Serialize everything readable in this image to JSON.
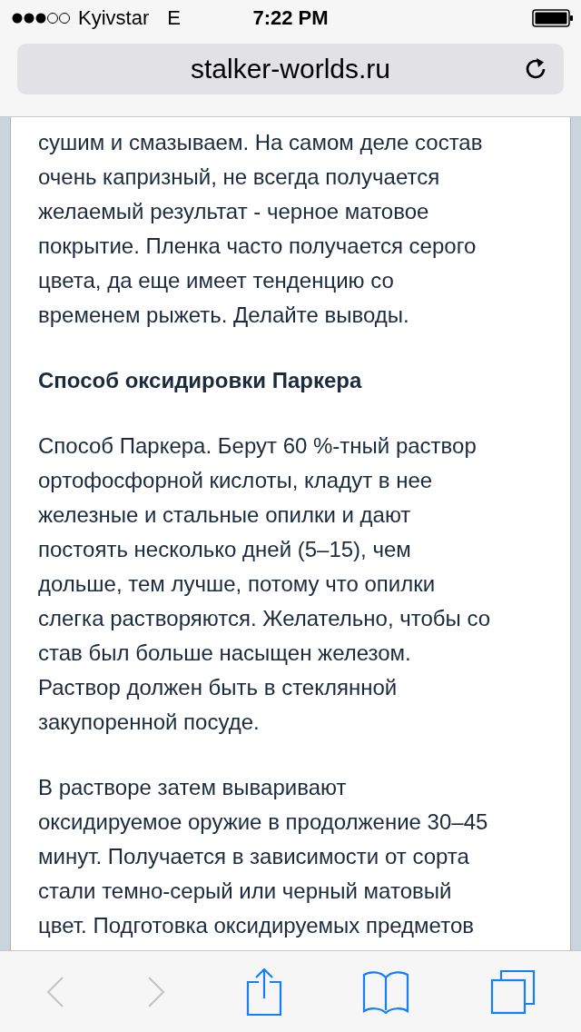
{
  "status_bar": {
    "carrier": "Kyivstar",
    "network": "E",
    "time": "7:22 PM"
  },
  "address_bar": {
    "url": "stalker-worlds.ru"
  },
  "article": [
    {
      "kind": "paragraph",
      "lines": [
        "сушим и смазываем. На самом деле состав",
        "очень капризный, не всегда получается",
        "желаемый результат - черное матовое",
        "покрытие. Пленка часто получается серого",
        "цвета, да еще имеет тенденцию со",
        "временем рыжеть. Делайте выводы."
      ]
    },
    {
      "kind": "heading",
      "lines": [
        "Способ оксидировки Паркера"
      ]
    },
    {
      "kind": "paragraph",
      "lines": [
        "Способ Паркера. Берут 60 %-тный раствор",
        "ортофосфорной кислоты, кладут в нее",
        "железные и стальные опилки и дают",
        "постоять несколько дней (5–15), чем",
        "дольше, тем лучше, потому что опилки",
        "слегка растворяются. Желательно, чтобы со",
        "став был больше насыщен железом.",
        "Раствор должен быть в стеклянной",
        "закупоренной посуде."
      ]
    },
    {
      "kind": "paragraph",
      "lines": [
        "В растворе затем вываривают",
        "оксидируемое оружие в продолжение 30–45",
        "минут. Получается в зависимости от сорта",
        "стали темно-серый или черный матовый",
        "цвет. Подготовка оксидируемых предметов"
      ]
    }
  ],
  "toolbar": [
    {
      "kind": "back",
      "disabled": true
    },
    {
      "kind": "forward",
      "disabled": true
    },
    {
      "kind": "share",
      "disabled": false
    },
    {
      "kind": "bookmarks",
      "disabled": false
    },
    {
      "kind": "tabs",
      "disabled": false
    }
  ]
}
